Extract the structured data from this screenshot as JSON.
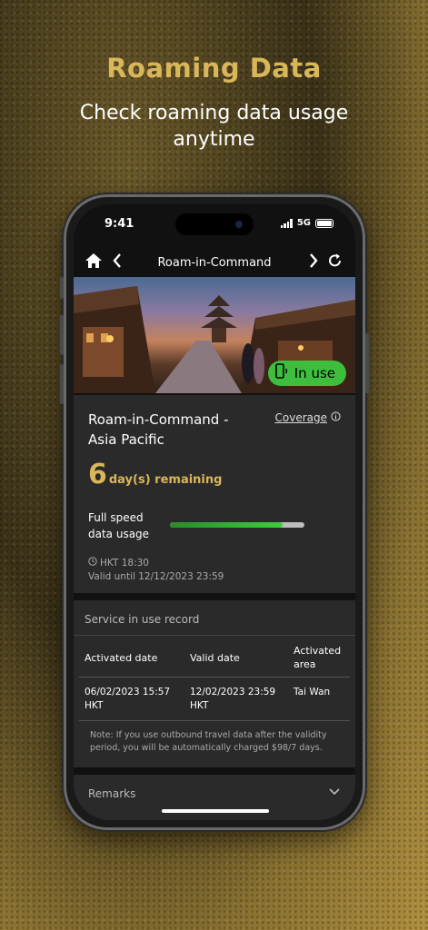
{
  "promo": {
    "headline": "Roaming Data",
    "subline": "Check roaming data usage anytime"
  },
  "colors": {
    "gold": "#d9b65a",
    "green": "#3dbf3d",
    "card": "#2a2a2a"
  },
  "status_bar": {
    "time": "9:41",
    "network": "5G"
  },
  "nav": {
    "title": "Roam-in-Command",
    "home_icon": "home-icon",
    "back_icon": "chevron-left-icon",
    "forward_icon": "chevron-right-icon",
    "refresh_icon": "refresh-icon"
  },
  "hero": {
    "badge": "In use",
    "badge_icon": "phone-signal-icon"
  },
  "plan": {
    "name": "Roam-in-Command - Asia Pacific",
    "coverage_link": "Coverage",
    "coverage_icon": "info-icon",
    "days_number": "6",
    "days_label": "day(s) remaining",
    "speed_label": "Full speed data usage",
    "usage_fraction": 0.84,
    "time": "HKT 18:30",
    "valid_until": "Valid until 12/12/2023 23:59"
  },
  "record": {
    "heading": "Service in use record",
    "columns": [
      "Activated date",
      "Valid date",
      "Activated area"
    ],
    "rows": [
      [
        "06/02/2023 15:57 HKT",
        "12/02/2023 23:59 HKT",
        "Tai Wan"
      ]
    ],
    "note": "Note: If you use outbound travel data after the validity period, you will be automatically charged $98/7 days."
  },
  "remarks": {
    "label": "Remarks",
    "icon": "chevron-down-icon"
  }
}
